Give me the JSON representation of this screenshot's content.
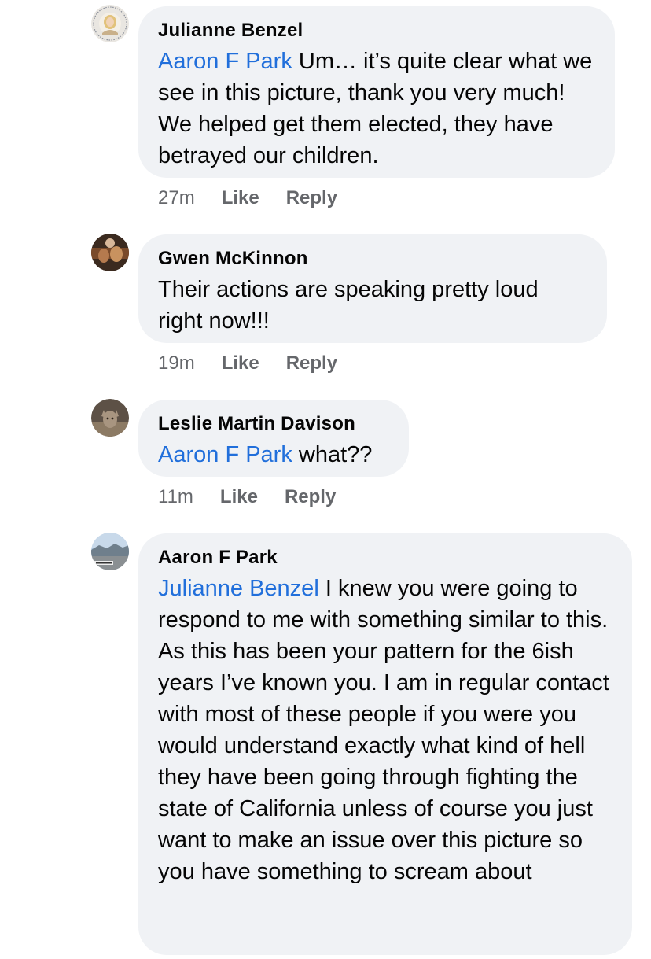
{
  "comments": [
    {
      "author": "Julianne Benzel",
      "mention": "Aaron F Park",
      "text": " Um… it’s quite clear what we see in this picture, thank you very much! We helped get them elected, they have betrayed our children.",
      "time": "27m",
      "like": "Like",
      "reply": "Reply"
    },
    {
      "author": "Gwen McKinnon",
      "mention": "",
      "text": "Their actions are speaking pretty loud right now!!!",
      "time": "19m",
      "like": "Like",
      "reply": "Reply"
    },
    {
      "author": "Leslie Martin Davison",
      "mention": "Aaron F Park",
      "text": " what??",
      "time": "11m",
      "like": "Like",
      "reply": "Reply"
    },
    {
      "author": "Aaron F Park",
      "mention": "Julianne Benzel",
      "text": " I knew you were going to respond to me with something similar to this. As this has been your pattern for the 6ish years I’ve known you. I am in regular contact with most of these people if you were you would understand exactly what kind of hell they have been going through fighting the state of California unless of course you just want to make an issue over this picture so you have something to scream about"
    }
  ]
}
